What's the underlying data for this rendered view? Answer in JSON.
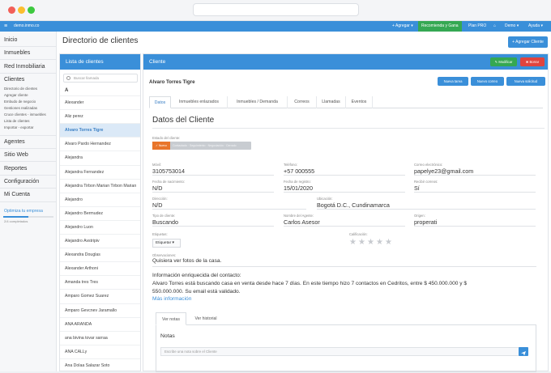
{
  "topbar": {
    "brand": "demo.inmo.co",
    "agregar": "Agregar",
    "recomienda": "Recomienda y Gana",
    "plan": "Plan PRO",
    "demo": "Demo",
    "ayuda": "Ayuda"
  },
  "sidebar": {
    "inicio": "Inicio",
    "inmuebles": "Inmuebles",
    "red": "Red Inmobiliaria",
    "clientes": "Clientes",
    "sub": [
      "Directorio de clientes",
      "Agregar cliente",
      "Embudo de negocio",
      "Gestiones realizadas",
      "Cruce clientes - inmuebles",
      "Lista de clientes",
      "Importar - exportar"
    ],
    "agentes": "Agentes",
    "sitio": "Sitio Web",
    "reportes": "Reportes",
    "config": "Configuración",
    "cuenta": "Mi Cuenta",
    "optimiza": "Optimiza tu empresa",
    "completado": "2/4 completados",
    "optimiza_progress": 0.5
  },
  "page": {
    "title": "Directorio de clientes",
    "add_button": "+ Agregar Cliente"
  },
  "list": {
    "header": "Lista de clientes",
    "search_placeholder": "Buscar llamada",
    "letter": "A",
    "clients": [
      "Alexander",
      "Aliz perez",
      "Alvaro Torres Tigre",
      "Alvaro Pardo Hernandez",
      "Alejandra",
      "Alejandra Fernandez",
      "Alejandra Tirbon Marian Tirbon Marian",
      "Alejandro",
      "Alejandro Bermudez",
      "Alejandro Luon",
      "Alejandro Avstripiv",
      "Alexandra Douglas",
      "Alexander Arthoni",
      "Amanda tres Tres",
      "Amparo Gomez Suarez",
      "Amparo Gevcnev Jaramallo",
      "ANA ARANDA",
      "ana bivina tovar sarraa",
      "ANA CALLy",
      "Ana Dolaa Salazar Soto"
    ],
    "active_index": 2
  },
  "detail": {
    "header": "Cliente",
    "modificar": "Modificar",
    "borrar": "Borrar",
    "client_name": "Alvaro Torres Tigre",
    "nueva_tarea": "Nueva tarea",
    "nuevo_correo": "Nuevo correo",
    "nueva_solicitud": "Nueva solicitud",
    "tabs": [
      "Datos",
      "Inmuebles enlazados",
      "Inmuebles / Demanda",
      "Correos",
      "Llamadas",
      "Eventos"
    ],
    "section_title": "Datos del Cliente",
    "estado_label": "Estado del cliente:",
    "estado_active": "Nuevo",
    "estado_rest": "Contactado · Seguimiento · Negociación · Cerrado",
    "fields": {
      "movil_label": "Móvil:",
      "movil": "3105753014",
      "tel_label": "Teléfono:",
      "tel": "+57 000555",
      "correo_label": "Correo electrónico:",
      "correo": "papelye23@gmail.com",
      "nac_label": "Fecha de nacimiento:",
      "nac": "N/D",
      "reg_label": "Fecha de registro:",
      "reg": "15/01/2020",
      "recibir_label": "Recibir correos:",
      "recibir": "Sí",
      "dir_label": "Dirección:",
      "dir": "N/D",
      "ubic_label": "Ubicación:",
      "ubic": "Bogotá D.C., Cundinamarca",
      "tipo_label": "Tipo de cliente:",
      "tipo": "Buscando",
      "agente_label": "Nombre del Agente:",
      "agente": "Carlos Asesor",
      "origen_label": "Origen:",
      "origen": "properati",
      "etiquetas_label": "Etiquetas:",
      "etiquetar": "Etiquetar",
      "calif_label": "Calificación:",
      "obs_label": "Observaciones:",
      "obs": "Quisiera ver fotos de la casa.",
      "enr_title": "Información enriquecida del contacto:",
      "enr_line1": "Alvaro Torres está buscando casa en venta desde hace 7 días. En este tiempo hizo 7 contactos en Cedritos, entre $ 450.000.000 y $",
      "enr_line2": "550.000.000. Su email está validado.",
      "mas_info": "Más información"
    },
    "rating": 0,
    "notes_tabs": [
      "Ver notas",
      "Ver historial"
    ],
    "notes_title": "Notas",
    "notes_placeholder": "Escribe una nota sobre el Cliente"
  }
}
